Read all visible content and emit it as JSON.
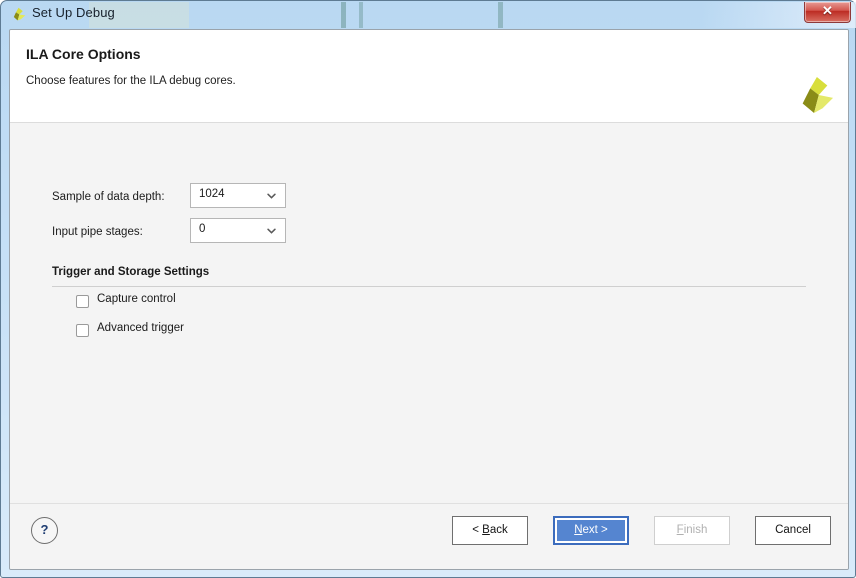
{
  "window": {
    "title": "Set Up Debug",
    "app_icon": "vivado-logo-icon",
    "close_label": "✕"
  },
  "header": {
    "title": "ILA Core Options",
    "subtitle": "Choose features for the ILA debug cores.",
    "logo": "xilinx-pinwheel-logo"
  },
  "form": {
    "fields": [
      {
        "label": "Sample of data depth:",
        "value": "1024"
      },
      {
        "label": "Input pipe stages:",
        "value": "0"
      }
    ],
    "section": {
      "title": "Trigger and Storage Settings",
      "checkboxes": [
        {
          "label": "Capture control",
          "checked": false
        },
        {
          "label": "Advanced trigger",
          "checked": false
        }
      ]
    }
  },
  "footer": {
    "help_label": "?",
    "buttons": {
      "back": {
        "prefix": "< ",
        "mnemonic": "B",
        "rest": "ack",
        "state": "enabled"
      },
      "next": {
        "prefix": "",
        "mnemonic": "N",
        "rest": "ext >",
        "state": "default"
      },
      "finish": {
        "prefix": "",
        "mnemonic": "F",
        "rest": "inish",
        "state": "disabled"
      },
      "cancel": {
        "prefix": "",
        "mnemonic": "",
        "rest": "Cancel",
        "state": "enabled"
      }
    }
  },
  "colors": {
    "accent_blue": "#5585d0",
    "accent_border": "#3c6cbd",
    "close_red": "#bc2c23",
    "logo_yellow": "#d8de3c",
    "logo_olive": "#8a8c17",
    "body_bg": "#f4f4f4"
  }
}
